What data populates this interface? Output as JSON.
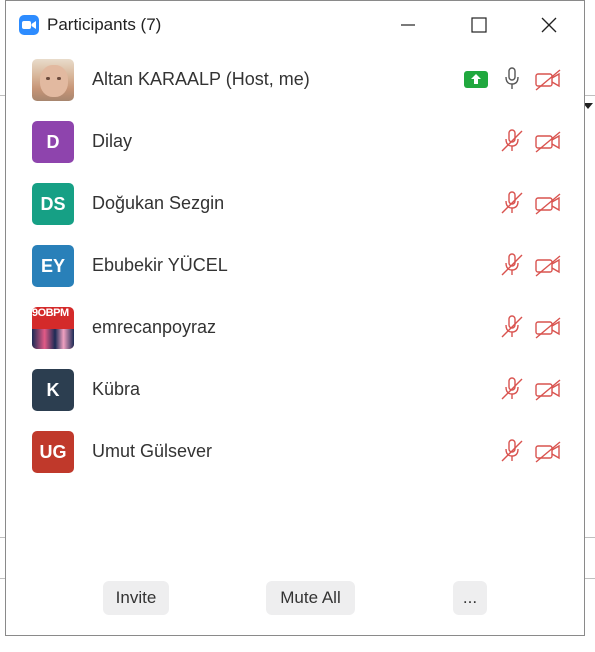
{
  "window": {
    "title": "Participants (7)",
    "app_icon": "zoom-camera-icon",
    "controls": [
      "minimize-icon",
      "maximize-icon",
      "close-icon"
    ]
  },
  "participants": [
    {
      "name": "Altan KARAALP (Host, me)",
      "avatar_type": "photo",
      "avatar_text": "",
      "share_screen": true,
      "audio": "unmuted",
      "video": "off"
    },
    {
      "name": "Dilay",
      "avatar_type": "initials",
      "avatar_text": "D",
      "avatar_color": "#8e44ad",
      "audio": "muted",
      "video": "off"
    },
    {
      "name": "Doğukan Sezgin",
      "avatar_type": "initials",
      "avatar_text": "DS",
      "avatar_color": "#16a085",
      "audio": "muted",
      "video": "off"
    },
    {
      "name": "Ebubekir YÜCEL",
      "avatar_type": "initials",
      "avatar_text": "EY",
      "avatar_color": "#2980b9",
      "audio": "muted",
      "video": "off"
    },
    {
      "name": "emrecanpoyraz",
      "avatar_type": "photo",
      "avatar_text": "9OBPM",
      "audio": "muted",
      "video": "off"
    },
    {
      "name": "Kübra",
      "avatar_type": "initials",
      "avatar_text": "K",
      "avatar_color": "#2c3e50",
      "audio": "muted",
      "video": "off"
    },
    {
      "name": "Umut Gülsever",
      "avatar_type": "initials",
      "avatar_text": "UG",
      "avatar_color": "#c0392b",
      "audio": "muted",
      "video": "off"
    }
  ],
  "footer": {
    "invite_label": "Invite",
    "mute_all_label": "Mute All",
    "more_label": "..."
  },
  "colors": {
    "muted_icon": "#d9534f",
    "unmuted_icon": "#555555",
    "share_badge": "#20a83e",
    "zoom_blue": "#2d8cff"
  }
}
